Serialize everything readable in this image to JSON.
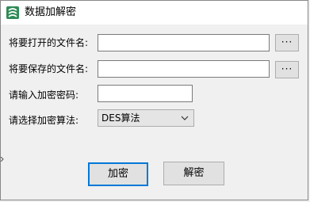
{
  "window": {
    "title": "数据加解密",
    "icon": "app-icon"
  },
  "form": {
    "open_file_label": "将要打开的文件名:",
    "open_file_value": "",
    "open_browse_label": "···",
    "save_file_label": "将要保存的文件名:",
    "save_file_value": "",
    "save_browse_label": "···",
    "password_label": "请输入加密密码:",
    "password_value": "",
    "algorithm_label": "请选择加密算法:",
    "algorithm_selected": "DES算法"
  },
  "buttons": {
    "encrypt": "加密",
    "decrypt": "解密"
  },
  "colors": {
    "focus_border": "#0078d7",
    "icon_green": "#2e8b57"
  }
}
